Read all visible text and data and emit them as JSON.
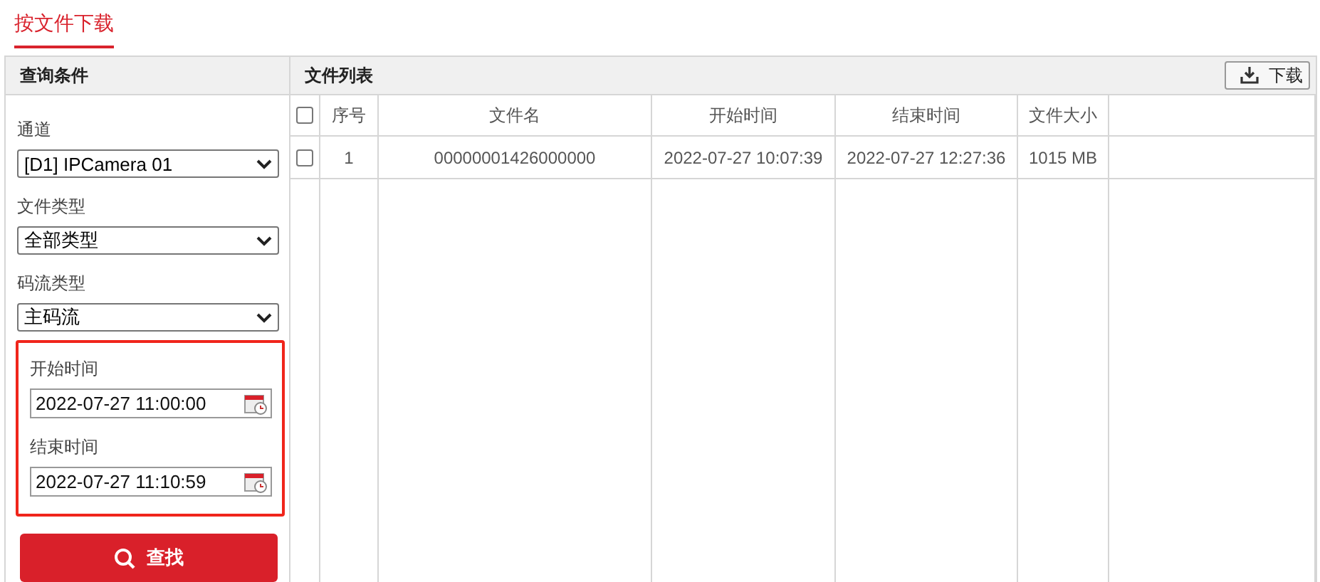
{
  "page_tab": {
    "label": "按文件下载",
    "selected": true
  },
  "query_panel": {
    "title": "查询条件",
    "fields": [
      {
        "kind": "select",
        "label": "通道",
        "value": "[D1] IPCamera 01",
        "highlighted": false
      },
      {
        "kind": "select",
        "label": "文件类型",
        "value": "全部类型",
        "highlighted": false
      },
      {
        "kind": "select",
        "label": "码流类型",
        "value": "主码流",
        "highlighted": false
      },
      {
        "kind": "datetime",
        "label": "开始时间",
        "value": "2022-07-27 11:00:00",
        "highlighted": true
      },
      {
        "kind": "datetime",
        "label": "结束时间",
        "value": "2022-07-27 11:10:59",
        "highlighted": true
      }
    ],
    "search_button": "查找"
  },
  "file_list": {
    "title": "文件列表",
    "download_button": "下载",
    "columns": [
      "序号",
      "文件名",
      "开始时间",
      "结束时间",
      "文件大小"
    ],
    "all_checked": false,
    "rows": [
      {
        "checked": false,
        "cells": [
          "1",
          "00000001426000000",
          "2022-07-27 10:07:39",
          "2022-07-27 12:27:36",
          "1015 MB"
        ]
      }
    ]
  }
}
